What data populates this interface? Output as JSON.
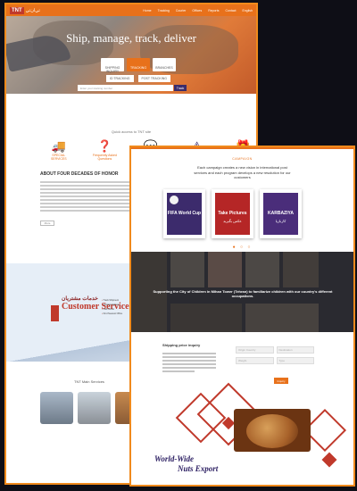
{
  "back_page": {
    "nav": {
      "logo": "TNT",
      "logo_ar": "تي‌ان‌تي",
      "menu": [
        "Home",
        "Tracking",
        "Courier",
        "Offices",
        "Reports",
        "Contact",
        "English"
      ]
    },
    "hero": {
      "title": "Ship, manage, track, deliver",
      "buttons": [
        {
          "label": "SHIPPING INQUIRY",
          "active": false
        },
        {
          "label": "TRACKING",
          "active": true
        },
        {
          "label": "BRANCHES",
          "active": false
        }
      ],
      "tabs": [
        "ID TRACKING",
        "POST TRACKING"
      ],
      "search_placeholder": "Enter your tracking number",
      "track_button": "Track"
    },
    "quick_access_title": "Quick access to TNT site",
    "services": [
      {
        "icon": "truck-icon",
        "label": "SPECIAL SERVICES"
      },
      {
        "icon": "question-icon",
        "label": "Frequently Asked Questions"
      },
      {
        "icon": "chat-icon",
        "label": ""
      },
      {
        "icon": "warning-icon",
        "label": ""
      },
      {
        "icon": "gift-icon",
        "label": ""
      }
    ],
    "about_heading": "ABOUT FOUR DECADES OF HONOR",
    "more_button": "More",
    "customer_service": {
      "title_ar": "خدمات مشتریان",
      "title_en": "Customer Service",
      "items": [
        "Track Shipment",
        "Contact Address",
        "Call Center",
        "Find Nearest Office"
      ]
    },
    "services_title": "TNT Main Services"
  },
  "front_page": {
    "campaign_label": "CAMPAIGN",
    "campaign_text": "Each campaign creates a new vision in international post services and each program develops a new resolution for our customers",
    "cards": [
      {
        "title": "FIFA World Cup",
        "subtitle": "",
        "color": "#3c2b6c"
      },
      {
        "title": "Take Pictures",
        "subtitle": "عکس بگیرید",
        "color": "#b52626"
      },
      {
        "title": "KARBAZIYA",
        "subtitle": "کاربازیا",
        "color": "#4a2d7a"
      }
    ],
    "dark_section_text": "Supporting the City of Children in Mihan Tower (Tehran) to familiarize children with our country's different occupations.",
    "inquiry_title": "Shipping price inquiry",
    "form": {
      "origin_placeholder": "Origin Country",
      "destination_placeholder": "Destination",
      "weight_placeholder": "Weight",
      "type_placeholder": "Type",
      "button": "Inquiry"
    },
    "nuts": {
      "line1": "World-Wide",
      "line2": "Nuts Export"
    }
  }
}
